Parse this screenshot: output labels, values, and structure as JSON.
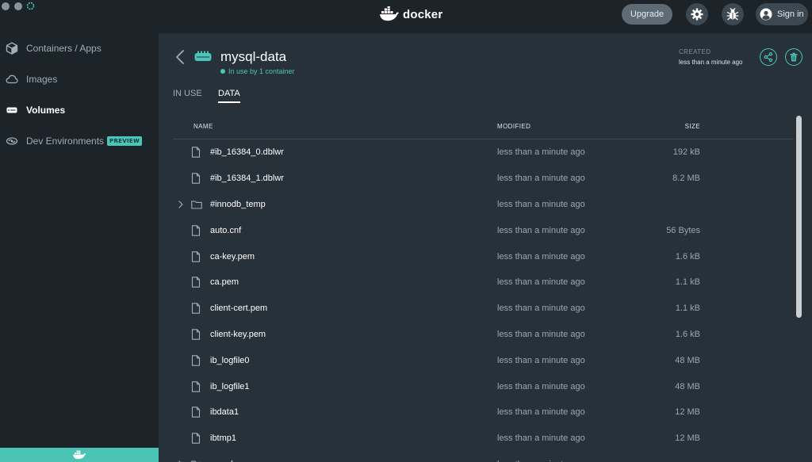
{
  "app": {
    "brand": "docker"
  },
  "header": {
    "upgrade_label": "Upgrade",
    "signin_label": "Sign in",
    "icons": [
      "settings-gear-icon",
      "bug-icon",
      "user-avatar-icon"
    ]
  },
  "sidebar": {
    "items": [
      {
        "label": "Containers / Apps",
        "icon": "container-cube-icon",
        "active": false
      },
      {
        "label": "Images",
        "icon": "cloud-icon",
        "active": false
      },
      {
        "label": "Volumes",
        "icon": "volume-disk-icon",
        "active": true
      },
      {
        "label": "Dev Environments",
        "icon": "dev-environments-icon",
        "active": false,
        "badge": "PREVIEW"
      }
    ]
  },
  "volume": {
    "name": "mysql-data",
    "status": "In use by 1 container",
    "created_label": "CREATED",
    "created_value": "less than a minute ago"
  },
  "tabs": [
    {
      "label": "IN USE",
      "active": false
    },
    {
      "label": "DATA",
      "active": true
    }
  ],
  "table": {
    "columns": {
      "name": "NAME",
      "modified": "MODIFIED",
      "size": "SIZE"
    },
    "rows": [
      {
        "name": "#ib_16384_0.dblwr",
        "modified": "less than a minute ago",
        "size": "192 kB",
        "type": "file"
      },
      {
        "name": "#ib_16384_1.dblwr",
        "modified": "less than a minute ago",
        "size": "8.2 MB",
        "type": "file"
      },
      {
        "name": "#innodb_temp",
        "modified": "less than a minute ago",
        "size": "",
        "type": "folder"
      },
      {
        "name": "auto.cnf",
        "modified": "less than a minute ago",
        "size": "56 Bytes",
        "type": "file"
      },
      {
        "name": "ca-key.pem",
        "modified": "less than a minute ago",
        "size": "1.6 kB",
        "type": "file"
      },
      {
        "name": "ca.pem",
        "modified": "less than a minute ago",
        "size": "1.1 kB",
        "type": "file"
      },
      {
        "name": "client-cert.pem",
        "modified": "less than a minute ago",
        "size": "1.1 kB",
        "type": "file"
      },
      {
        "name": "client-key.pem",
        "modified": "less than a minute ago",
        "size": "1.6 kB",
        "type": "file"
      },
      {
        "name": "ib_logfile0",
        "modified": "less than a minute ago",
        "size": "48 MB",
        "type": "file"
      },
      {
        "name": "ib_logfile1",
        "modified": "less than a minute ago",
        "size": "48 MB",
        "type": "file"
      },
      {
        "name": "ibdata1",
        "modified": "less than a minute ago",
        "size": "12 MB",
        "type": "file"
      },
      {
        "name": "ibtmp1",
        "modified": "less than a minute ago",
        "size": "12 MB",
        "type": "file"
      },
      {
        "name": "mysql",
        "modified": "less than a minute ago",
        "size": "",
        "type": "folder"
      }
    ]
  },
  "colors": {
    "accent": "#4cc5b8",
    "sidebar_bg": "#1c2329",
    "main_bg": "#27313a"
  }
}
